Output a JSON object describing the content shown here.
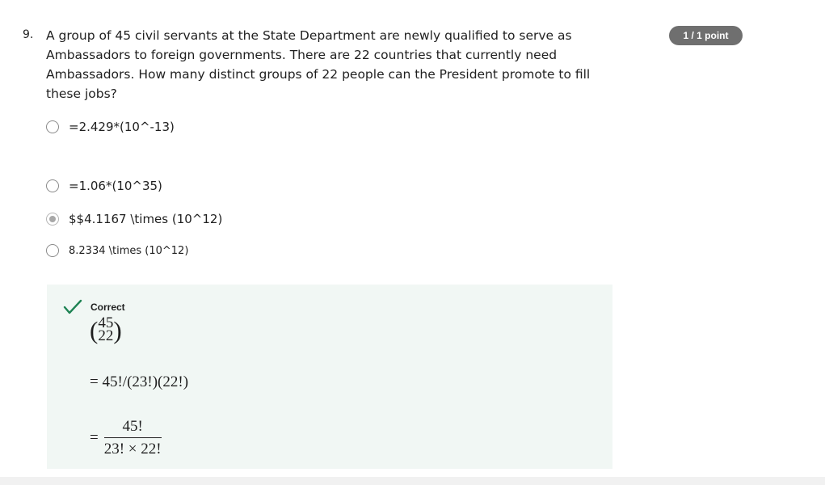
{
  "question": {
    "number": "9.",
    "text": "A group of 45 civil servants at the State Department are newly qualified to serve as Ambassadors to foreign governments. There are 22 countries that currently need Ambassadors. How many distinct groups of 22 people can the President promote to fill these jobs?",
    "points": "1 / 1 point"
  },
  "options": [
    {
      "label": "=2.429*(10^-13)",
      "selected": false
    },
    {
      "label": "=1.06*(10^35)",
      "selected": false
    },
    {
      "label": "$$4.1167 \\times (10^12)",
      "selected": true
    },
    {
      "label": "8.2334 \\times (10^12)",
      "selected": false
    }
  ],
  "feedback": {
    "status": "Correct",
    "binom_n": "45",
    "binom_k": "22",
    "eq1": "= 45!/(23!)(22!)",
    "eq2_prefix": "=",
    "frac_num": "45!",
    "frac_den": "23! × 22!"
  },
  "colors": {
    "correct_green": "#1f8354",
    "feedback_bg": "#f1f7f4",
    "badge_bg": "#6f6f6f"
  }
}
